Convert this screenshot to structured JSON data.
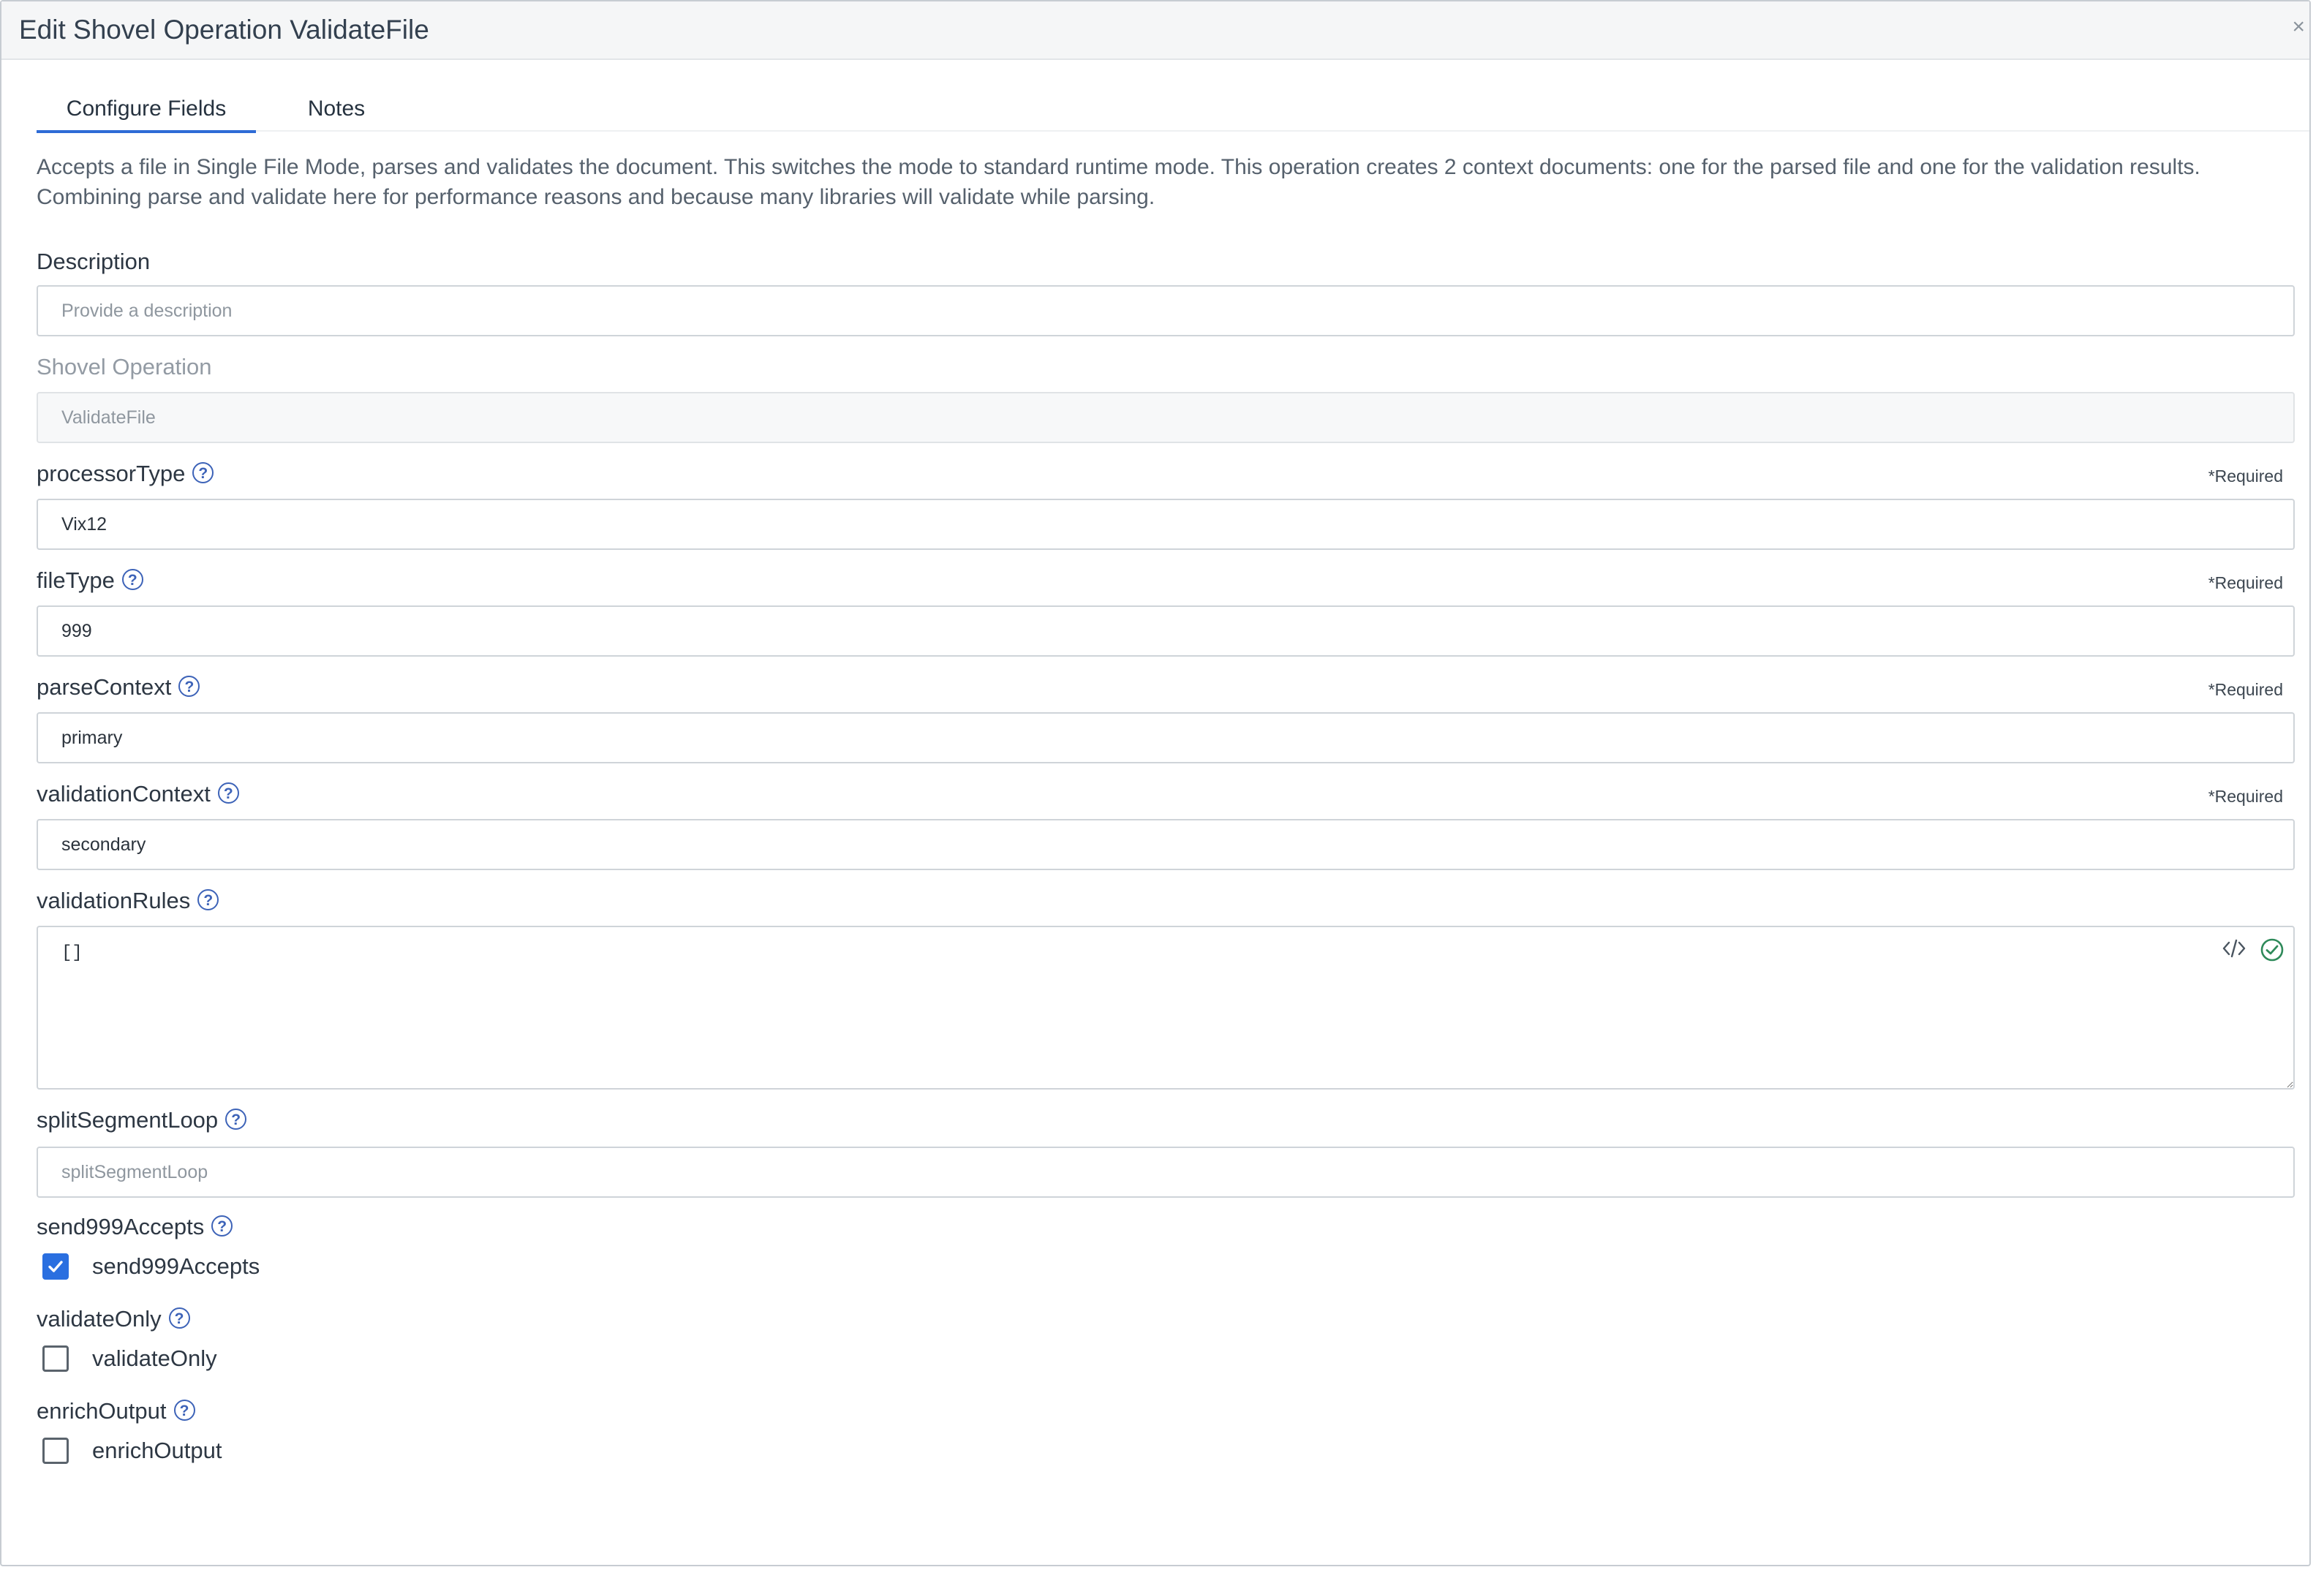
{
  "dialog": {
    "title": "Edit Shovel Operation ValidateFile",
    "close_glyph": "×"
  },
  "tabs": [
    {
      "label": "Configure Fields",
      "active": true
    },
    {
      "label": "Notes",
      "active": false
    }
  ],
  "description_text": "Accepts a file in Single File Mode, parses and validates the document. This switches the mode to standard runtime mode. This operation creates 2 context documents: one for the parsed file and one for the validation results. Combining parse and validate here for performance reasons and because many libraries will validate while parsing.",
  "fields": {
    "description": {
      "label": "Description",
      "value": "",
      "placeholder": "Provide a description"
    },
    "shovel_operation": {
      "label": "Shovel Operation",
      "value": "ValidateFile"
    },
    "processorType": {
      "label": "processorType",
      "value": "Vix12",
      "required": "*Required"
    },
    "fileType": {
      "label": "fileType",
      "value": "999",
      "required": "*Required"
    },
    "parseContext": {
      "label": "parseContext",
      "value": "primary",
      "required": "*Required"
    },
    "validationContext": {
      "label": "validationContext",
      "value": "secondary",
      "required": "*Required"
    },
    "validationRules": {
      "label": "validationRules",
      "value": "[]"
    },
    "splitSegmentLoop": {
      "label": "splitSegmentLoop",
      "value": "",
      "placeholder": "splitSegmentLoop"
    },
    "send999Accepts": {
      "label": "send999Accepts",
      "checkbox_label": "send999Accepts",
      "checked": true
    },
    "validateOnly": {
      "label": "validateOnly",
      "checkbox_label": "validateOnly",
      "checked": false
    },
    "enrichOutput": {
      "label": "enrichOutput",
      "checkbox_label": "enrichOutput",
      "checked": false
    }
  },
  "help_glyph": "?",
  "colors": {
    "accent": "#2e6bd6",
    "help_icon": "#3d63b8",
    "valid_check": "#2f8a5a"
  }
}
